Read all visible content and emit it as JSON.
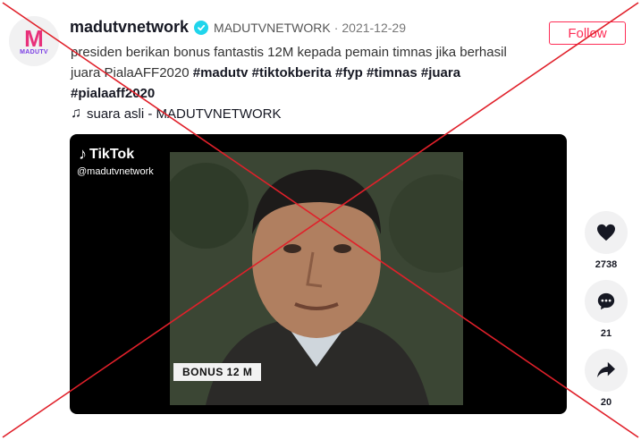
{
  "account": {
    "avatar_text": "M",
    "avatar_subtext": "MADUTV",
    "username": "madutvnetwork",
    "nickname": "MADUTVNETWORK",
    "separator": "·",
    "date": "2021-12-29"
  },
  "follow_label": "Follow",
  "caption": {
    "text": "presiden berikan bonus fantastis 12M kepada pemain timnas jika berhasil juara PialaAFF2020",
    "hashtags": [
      "#madutv",
      "#tiktokberita",
      "#fyp",
      "#timnas",
      "#juara",
      "#pialaaff2020"
    ]
  },
  "music": {
    "icon": "music-note-icon",
    "label": "suara asli - MADUTVNETWORK"
  },
  "video": {
    "watermark_brand": "TikTok",
    "watermark_handle": "@madutvnetwork",
    "overlay_text": "BONUS 12 M"
  },
  "actions": {
    "like": {
      "icon": "heart-icon",
      "count": "2738"
    },
    "comment": {
      "icon": "comment-icon",
      "count": "21"
    },
    "share": {
      "icon": "share-icon",
      "count": "20"
    }
  },
  "colors": {
    "accent": "#fe2c55",
    "verified": "#20d5ec",
    "cross_mark": "#e0202a"
  }
}
